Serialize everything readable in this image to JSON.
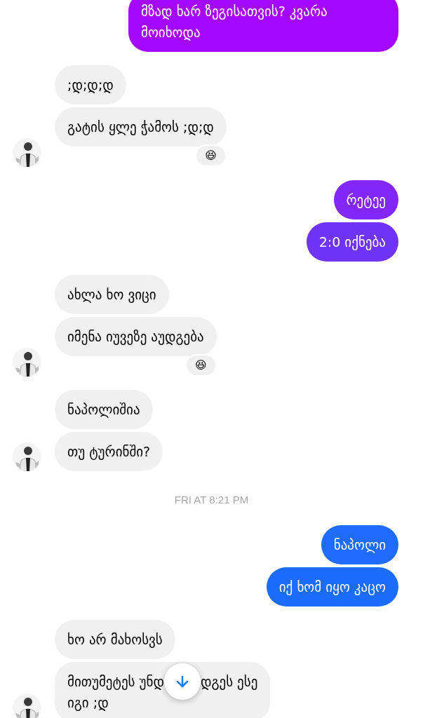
{
  "items": [
    {
      "kind": "outgoing",
      "messages": [
        {
          "text": "მზად ხარ ზეგისათვის? კვარა მოიხოდა",
          "color": "#a307fd"
        }
      ]
    },
    {
      "kind": "incoming",
      "messages": [
        {
          "kind": "text",
          "text": ";დ;დ;დ"
        },
        {
          "kind": "text",
          "text": "გატის ყლე ჭამოს ;დ;დ",
          "reaction": "😆"
        }
      ]
    },
    {
      "kind": "outgoing",
      "messages": [
        {
          "text": "რეტეე",
          "color": "#8226fa"
        },
        {
          "text": "2:0 იქნება",
          "color": "#7033f8"
        }
      ]
    },
    {
      "kind": "incoming",
      "messages": [
        {
          "kind": "text",
          "text": "ახლა ხო ვიცი"
        },
        {
          "kind": "text",
          "text": "იმენა იუვეზე აუდგება",
          "reaction": "😆"
        }
      ]
    },
    {
      "kind": "incoming",
      "messages": [
        {
          "kind": "text",
          "text": "ნაპოლიშია"
        },
        {
          "kind": "text",
          "text": "თუ ტურინში?"
        }
      ]
    },
    {
      "kind": "timestamp",
      "text": "FRI AT 8:21 PM"
    },
    {
      "kind": "outgoing",
      "messages": [
        {
          "text": "ნაპოლი",
          "color": "#1f6bfb"
        },
        {
          "text": "იქ ხომ იყო კაცო",
          "color": "#1c6cfb"
        }
      ]
    },
    {
      "kind": "incoming",
      "messages": [
        {
          "kind": "text",
          "text": "ხო არ მახოსვს"
        },
        {
          "kind": "covered",
          "before": "მითუმეტეს უნდ",
          "after": "დგეს ესე",
          "rest": "იგი ;დ"
        }
      ]
    }
  ]
}
